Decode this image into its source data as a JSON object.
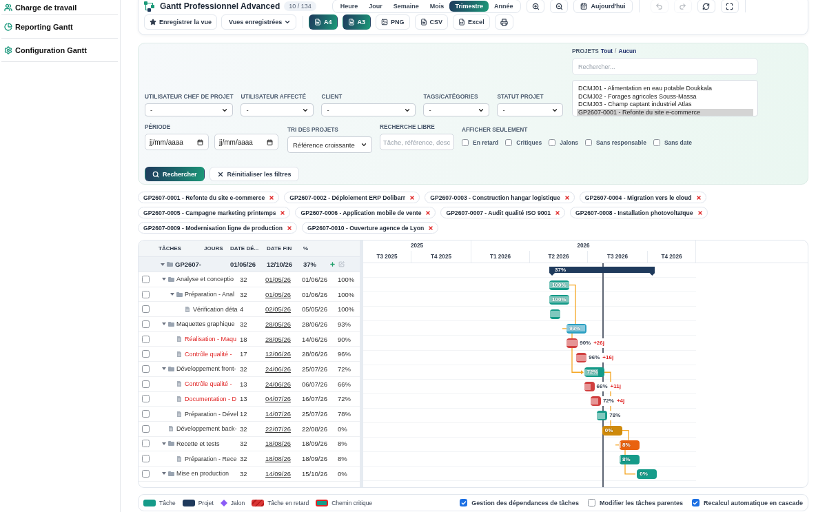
{
  "sidebar": {
    "items": [
      {
        "label": "Charge de travail"
      },
      {
        "label": "Reporting Gantt"
      },
      {
        "label": "Configuration Gantt"
      }
    ]
  },
  "header": {
    "title": "Gantt Professionnel Advanced",
    "count": "10 / 134",
    "scales": [
      {
        "label": "Heure",
        "selected": false
      },
      {
        "label": "Jour",
        "selected": false
      },
      {
        "label": "Semaine",
        "selected": false
      },
      {
        "label": "Mois",
        "selected": false
      },
      {
        "label": "Trimestre",
        "selected": true
      },
      {
        "label": "Année",
        "selected": false
      }
    ],
    "today_button": "Aujourd'hui",
    "undo": {
      "disabled": true
    },
    "redo": {
      "disabled": true
    },
    "save_view_button": "Enregistrer la vue",
    "saved_views": "Vues enregistrées",
    "exports": [
      {
        "label": "A4",
        "kind": "pdf"
      },
      {
        "label": "A3",
        "kind": "pdf"
      },
      {
        "label": "PNG",
        "kind": "image"
      },
      {
        "label": "CSV",
        "kind": "csv"
      },
      {
        "label": "Excel",
        "kind": "excel"
      }
    ]
  },
  "filters": {
    "selects": [
      {
        "label": "UTILISATEUR CHEF DE PROJET",
        "value": "-"
      },
      {
        "label": "UTILISATEUR AFFECTÉ",
        "value": "-"
      },
      {
        "label": "CLIENT",
        "value": "-"
      },
      {
        "label": "TAGS/CATÉGORIES",
        "value": "-"
      },
      {
        "label": "STATUT PROJET",
        "value": "-"
      }
    ],
    "projects": {
      "label": "PROJETS",
      "all_link": "Tout",
      "separator": "/",
      "none_link": "Aucun",
      "search_placeholder": "Rechercher...",
      "options": [
        {
          "label": "DCMJ01 - Alimentation en eau potable Doukkala",
          "selected": false
        },
        {
          "label": "DCMJ02 - Forages agricoles Souss-Massa",
          "selected": false
        },
        {
          "label": "DCMJ03 - Champ captant industriel Atlas",
          "selected": false
        },
        {
          "label": "GP2607-0001 - Refonte du site e-commerce",
          "selected": true
        }
      ]
    },
    "period": {
      "label": "PÉRIODE",
      "from_placeholder": "jj/mm/aaaa",
      "to_placeholder": "jj/mm/aaaa"
    },
    "sort": {
      "label": "TRI DES PROJETS",
      "value": "Référence croissante"
    },
    "free_search": {
      "label": "RECHERCHE LIBRE",
      "placeholder": "Tâche, référence, desc"
    },
    "show_only": {
      "label": "AFFICHER SEULEMENT",
      "options": [
        {
          "label": "En retard",
          "checked": false
        },
        {
          "label": "Critiques",
          "checked": false
        },
        {
          "label": "Jalons",
          "checked": false
        },
        {
          "label": "Sans responsable",
          "checked": false
        },
        {
          "label": "Sans date",
          "checked": false
        }
      ]
    },
    "search_button": "Rechercher",
    "reset_button": "Réinitialiser les filtres"
  },
  "selected_projects": [
    {
      "label": "GP2607-0001 - Refonte du site e-commerce"
    },
    {
      "label": "GP2607-0002 - Déploiement ERP Dolibarr"
    },
    {
      "label": "GP2607-0003 - Construction hangar logistique"
    },
    {
      "label": "GP2607-0004 - Migration vers le cloud"
    },
    {
      "label": "GP2607-0005 - Campagne marketing printemps"
    },
    {
      "label": "GP2607-0006 - Application mobile de vente"
    },
    {
      "label": "GP2607-0007 - Audit qualité ISO 9001"
    },
    {
      "label": "GP2607-0008 - Installation photovoltaïque"
    },
    {
      "label": "GP2607-0009 - Modernisation ligne de production"
    },
    {
      "label": "GP2607-0010 - Ouverture agence de Lyon"
    }
  ],
  "gantt": {
    "columns": [
      "TÂCHES",
      "JOURS",
      "DATE DÉ...",
      "DATE FIN",
      "%"
    ],
    "years": [
      "2025",
      "2026"
    ],
    "quarters": [
      "T3 2025",
      "T4 2025",
      "T1 2026",
      "T2 2026",
      "T3 2026",
      "T4 2026"
    ],
    "project": {
      "name": "GP2607-",
      "start": "01/05/26",
      "end": "12/10/26",
      "progress": "37%",
      "bar_label": "37%",
      "expanded": true,
      "children": [
        {
          "kind": "group",
          "name": "Analyse et conceptio",
          "days": "32",
          "start": "01/05/26",
          "end": "01/06/26",
          "progress": "100%",
          "bar_label": "100%",
          "level": 1,
          "color": "#169b89",
          "late": false,
          "checked": false,
          "expanded": true,
          "children": [
            {
              "kind": "group",
              "name": "Préparation - Anal",
              "days": "32",
              "start": "01/05/26",
              "end": "01/06/26",
              "progress": "100%",
              "bar_label": "100%",
              "level": 1,
              "color": "#169b89",
              "late": false,
              "checked": false,
              "expanded": true,
              "children": [
                {
                  "kind": "task",
                  "name": "Vérification déta",
                  "days": "4",
                  "start": "02/05/26",
                  "end": "05/05/26",
                  "progress": "100%",
                  "level": 1,
                  "color": "#169b89",
                  "late": false,
                  "checked": false
                }
              ]
            }
          ]
        },
        {
          "kind": "group",
          "name": "Maquettes graphique",
          "days": "32",
          "start": "28/05/26",
          "end": "28/06/26",
          "progress": "93%",
          "bar_label": "93%",
          "level": 0.93,
          "color": "#2a9fc2",
          "late": false,
          "checked": false,
          "expanded": true,
          "children": [
            {
              "kind": "task",
              "name": "Réalisation - Maqu",
              "days": "18",
              "start": "28/05/26",
              "end": "14/06/26",
              "progress": "90%",
              "bar_label": "90%",
              "delay": "+26j",
              "level": 0.9,
              "color": "#d13f3f",
              "late": true,
              "checked": false
            },
            {
              "kind": "task",
              "name": "Contrôle qualité -",
              "days": "17",
              "start": "12/06/26",
              "end": "28/06/26",
              "progress": "96%",
              "bar_label": "96%",
              "delay": "+16j",
              "level": 0.96,
              "color": "#d13f3f",
              "late": true,
              "checked": false
            }
          ]
        },
        {
          "kind": "group",
          "name": "Développement front-",
          "days": "32",
          "start": "24/06/26",
          "end": "25/07/26",
          "progress": "72%",
          "bar_label": "72%",
          "level": 0.72,
          "color": "#169b89",
          "late": false,
          "checked": false,
          "expanded": true,
          "children": [
            {
              "kind": "task",
              "name": "Contrôle qualité -",
              "days": "13",
              "start": "24/06/26",
              "end": "06/07/26",
              "progress": "66%",
              "bar_label": "66%",
              "delay": "+11j",
              "level": 0.66,
              "color": "#d13f3f",
              "late": true,
              "checked": false
            },
            {
              "kind": "task",
              "name": "Documentation - D",
              "days": "13",
              "start": "04/07/26",
              "end": "16/07/26",
              "progress": "72%",
              "bar_label": "72%",
              "delay": "+4j",
              "level": 0.72,
              "color": "#d13f3f",
              "late": true,
              "checked": false
            },
            {
              "kind": "task",
              "name": "Préparation - Dével",
              "days": "12",
              "start": "14/07/26",
              "end": "25/07/26",
              "progress": "78%",
              "bar_label": "78%",
              "level": 0.78,
              "color": "#169b89",
              "late": false,
              "checked": false
            }
          ]
        },
        {
          "kind": "task",
          "name": "Développement back-",
          "days": "32",
          "start": "22/07/26",
          "end": "22/08/26",
          "progress": "0%",
          "bar_label": "0%",
          "color": "#cf8a0b",
          "late": false,
          "checked": false
        },
        {
          "kind": "group",
          "name": "Recette et tests",
          "days": "32",
          "start": "18/08/26",
          "end": "18/09/26",
          "progress": "8%",
          "bar_label": "8%",
          "level": 0.08,
          "color": "#e9620f",
          "late": false,
          "checked": false,
          "expanded": true,
          "children": [
            {
              "kind": "task",
              "name": "Préparation - Rece",
              "days": "32",
              "start": "18/08/26",
              "end": "18/09/26",
              "progress": "8%",
              "bar_label": "8%",
              "level": 0.08,
              "color": "#169b89",
              "late": false,
              "checked": false
            }
          ]
        },
        {
          "kind": "group",
          "name": "Mise en production",
          "days": "32",
          "start": "14/09/26",
          "end": "15/10/26",
          "progress": "0%",
          "bar_label": "0%",
          "color": "#169b89",
          "late": false,
          "checked": false,
          "expanded": true
        }
      ]
    }
  },
  "legend": {
    "items": [
      {
        "label": "Tâche",
        "kind": "task"
      },
      {
        "label": "Projet",
        "kind": "project"
      },
      {
        "label": "Jalon",
        "kind": "milestone"
      },
      {
        "label": "Tâche en retard",
        "kind": "late"
      },
      {
        "label": "Chemin critique",
        "kind": "critical"
      }
    ],
    "options": [
      {
        "label": "Gestion des dépendances de tâches",
        "checked": true
      },
      {
        "label": "Modifier les tâches parentes",
        "checked": false
      },
      {
        "label": "Recalcul automatique en cascade",
        "checked": true
      }
    ]
  }
}
